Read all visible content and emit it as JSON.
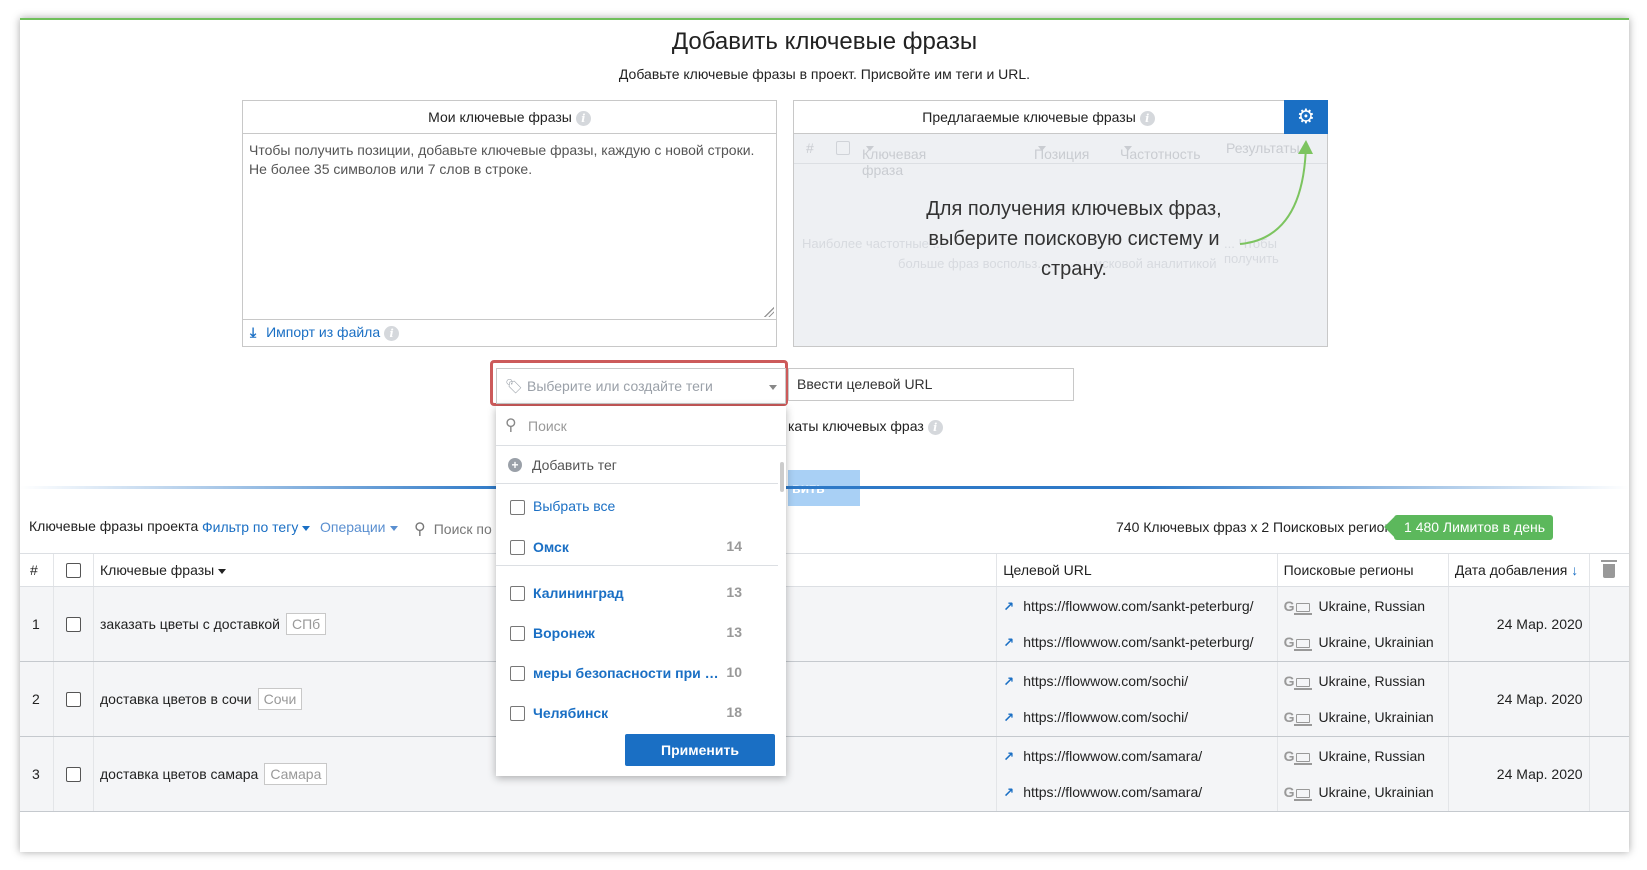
{
  "header": {
    "title": "Добавить ключевые фразы",
    "subtitle": "Добавьте ключевые фразы в проект. Присвойте им теги и URL."
  },
  "my_keywords": {
    "title": "Мои ключевые фразы",
    "placeholder": "Чтобы получить позиции, добавьте ключевые фразы, каждую с новой строки. Не более 35 символов или 7 слов в строке.",
    "import_label": "Импорт из файла"
  },
  "suggested": {
    "title": "Предлагаемые ключевые фразы",
    "columns": [
      "#",
      "Ключевая фраза",
      "Позиция",
      "Частотность",
      "Результаты"
    ],
    "ghost_line1": "Наиболее частотные ...",
    "ghost_line1b": "... Чтобы получить",
    "ghost_line2": "больше фраз воспольз...",
    "ghost_line2b": "...исковой аналитикой",
    "message": "Для получения ключевых фраз, выберите поисковую систему и страну."
  },
  "tags": {
    "placeholder": "Выберите или создайте теги"
  },
  "url_input": {
    "placeholder": "Ввести целевой URL"
  },
  "duplicates_text": "каты ключевых фраз",
  "add_button": "вить",
  "toolbar": {
    "label": "Ключевые фразы проекта",
    "filter": "Фильтр по тегу",
    "operations": "Операции",
    "search": "Поиск по",
    "count": "740 Ключевых фраз x 2 Поисковых региона =",
    "limit": "1 480 Лимитов в день"
  },
  "table": {
    "headers": {
      "num": "#",
      "keywords": "Ключевые фразы",
      "url": "Целевой URL",
      "regions": "Поисковые регионы",
      "date": "Дата добавления"
    },
    "rows": [
      {
        "num": "1",
        "keyword": "заказать цветы с доставкой",
        "tag": "СПб",
        "url1": "https://flowwow.com/sankt-peterburg/",
        "url2": "https://flowwow.com/sankt-peterburg/",
        "region1": "Ukraine, Russian",
        "region2": "Ukraine, Ukrainian",
        "date": "24 Мар. 2020"
      },
      {
        "num": "2",
        "keyword": "доставка цветов в сочи",
        "tag": "Сочи",
        "url1": "https://flowwow.com/sochi/",
        "url2": "https://flowwow.com/sochi/",
        "region1": "Ukraine, Russian",
        "region2": "Ukraine, Ukrainian",
        "date": "24 Мар. 2020"
      },
      {
        "num": "3",
        "keyword": "доставка цветов самара",
        "tag": "Самара",
        "url1": "https://flowwow.com/samara/",
        "url2": "https://flowwow.com/samara/",
        "region1": "Ukraine, Russian",
        "region2": "Ukraine, Ukrainian",
        "date": "24 Мар. 2020"
      }
    ]
  },
  "dropdown": {
    "search_placeholder": "Поиск",
    "add_tag": "Добавить тег",
    "select_all": "Выбрать все",
    "items": [
      {
        "label": "Омск",
        "count": "14"
      },
      {
        "label": "Калининград",
        "count": "13"
      },
      {
        "label": "Воронеж",
        "count": "13"
      },
      {
        "label": "меры безопасности при прок...",
        "count": "10"
      },
      {
        "label": "Челябинск",
        "count": "18"
      }
    ],
    "apply": "Применить"
  },
  "colors": {
    "accent": "#1a6fc4",
    "limit_green": "#5cb85c",
    "highlight_red": "#cc5a5a",
    "arrow_green": "#7cc45f"
  }
}
